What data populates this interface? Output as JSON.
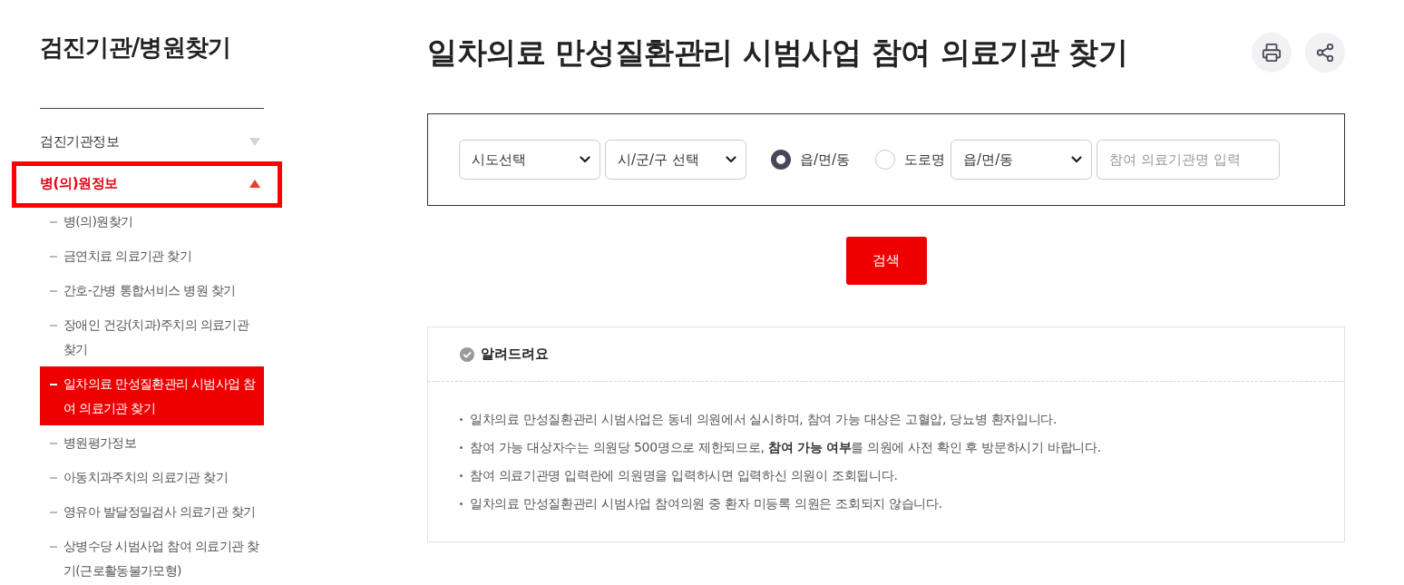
{
  "sidebar": {
    "title": "검진기관/병원찾기",
    "sections": [
      {
        "label": "검진기관정보",
        "expanded": false,
        "highlighted": false
      },
      {
        "label": "병(의)원정보",
        "expanded": true,
        "highlighted": true,
        "children": [
          {
            "label": "병(의)원찾기",
            "selected": false
          },
          {
            "label": "금연치료 의료기관 찾기",
            "selected": false
          },
          {
            "label": "간호-간병 통합서비스 병원 찾기",
            "selected": false
          },
          {
            "label": "장애인 건강(치과)주치의 의료기관 찾기",
            "selected": false
          },
          {
            "label": "일차의료 만성질환관리 시범사업 참여 의료기관 찾기",
            "selected": true
          },
          {
            "label": "병원평가정보",
            "selected": false
          },
          {
            "label": "아동치과주치의 의료기관 찾기",
            "selected": false
          },
          {
            "label": "영유아 발달정밀검사 의료기관 찾기",
            "selected": false
          },
          {
            "label": "상병수당 시범사업 참여 의료기관 찾기(근로활동불가모형)",
            "selected": false
          }
        ]
      }
    ]
  },
  "page_title": "일차의료 만성질환관리 시범사업 참여 의료기관 찾기",
  "search_form": {
    "fields": [
      {
        "kind": "select",
        "value": "시도선택"
      },
      {
        "kind": "select",
        "value": "시/군/구 선택"
      },
      {
        "kind": "radio",
        "label": "읍/면/동",
        "selected": true
      },
      {
        "kind": "radio",
        "label": "도로명",
        "selected": false
      },
      {
        "kind": "select",
        "value": "읍/면/동"
      },
      {
        "kind": "input",
        "placeholder": "참여 의료기관명 입력"
      }
    ],
    "search_button": "검색"
  },
  "notice": {
    "title": "알려드려요",
    "items": [
      "일차의료 만성질환관리 시범사업은 동네 의원에서 실시하며, 참여 가능 대상은 고혈압, 당뇨병 환자입니다.",
      "참여 가능 대상자수는 의원당 500명으로 제한되므로, **참여 가능 여부**를 의원에 사전 확인 후 방문하시기 바랍니다.",
      "참여 의료기관명 입력란에 의원명을 입력하시면 입력하신 의원이 조회됩니다.",
      "일차의료 만성질환관리 시범사업 참여의원 중 환자 미등록 의원은 조회되지 않습니다."
    ]
  }
}
